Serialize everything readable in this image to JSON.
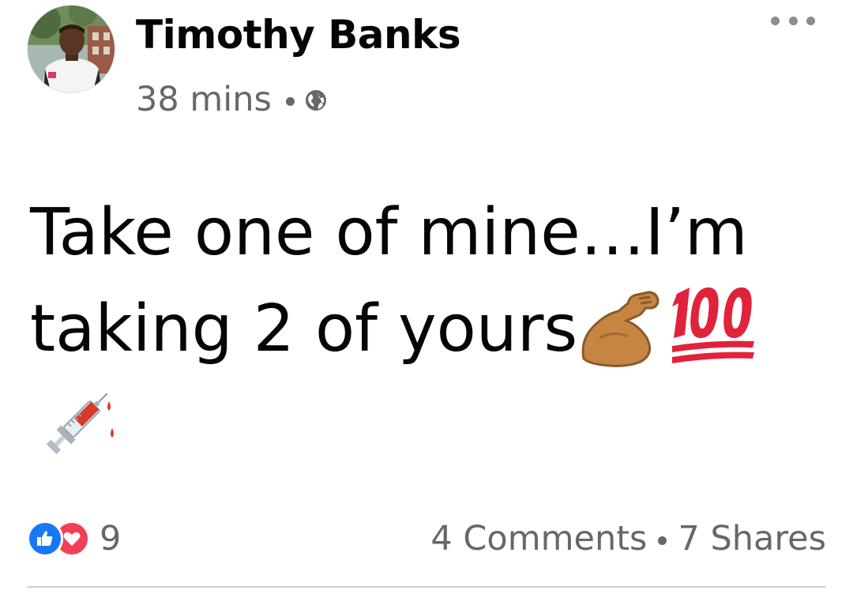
{
  "post": {
    "author": "Timothy Banks",
    "time": "38 mins",
    "privacy_icon": "globe-icon",
    "text_line1": "Take one of mine…I’m",
    "text_line2": "taking 2 of yours",
    "emojis": [
      "flexed-biceps",
      "hundred-points",
      "syringe"
    ]
  },
  "reactions": {
    "types": [
      "like",
      "love"
    ],
    "count": "9"
  },
  "stats": {
    "comments": "4 Comments",
    "shares": "7 Shares"
  },
  "colors": {
    "text": "#050505",
    "secondary_text": "#65676b",
    "like_blue": "#1877f2",
    "love_red": "#f33e58",
    "divider": "#ced0d4"
  }
}
